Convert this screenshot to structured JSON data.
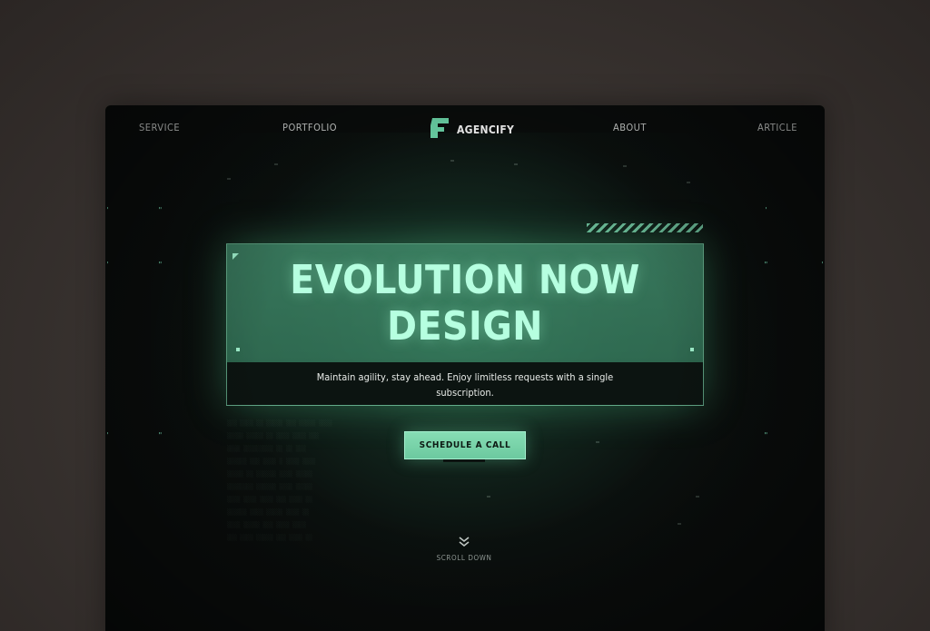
{
  "nav": {
    "links": [
      {
        "label": "SERVICE"
      },
      {
        "label": "PORTFOLIO"
      },
      {
        "label": "ABOUT"
      },
      {
        "label": "ARTICLE"
      }
    ],
    "brand": {
      "name": "AGENCIFY",
      "logo_icon": "agencify-logo-icon"
    }
  },
  "hero": {
    "title_line1": "EVOLUTION NOW",
    "title_line2": "DESIGN",
    "subtitle_line1": "Maintain agility, stay ahead. Enjoy limitless requests with a single",
    "subtitle_line2": "subscription."
  },
  "cta": {
    "label": "SCHEDULE A CALL"
  },
  "scroll": {
    "label": "SCROLL DOWN",
    "icon": "double-chevron-down-icon"
  },
  "colors": {
    "accent": "#86ddb4",
    "accent_light": "#b6ffe0",
    "background": "#0a0d0c",
    "outer_background": "#3a3431"
  }
}
